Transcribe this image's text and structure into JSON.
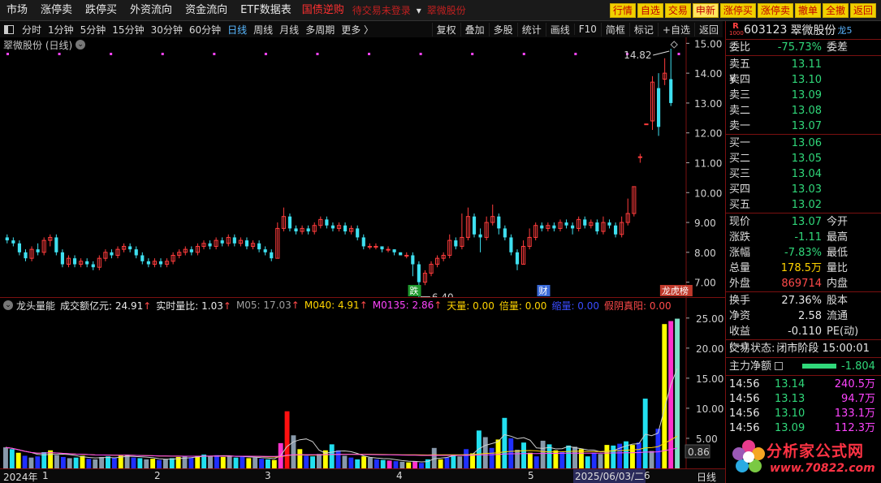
{
  "menu": {
    "items": [
      "市场",
      "涨停卖",
      "跌停买",
      "外资流向",
      "资金流向",
      "ETF数据表"
    ],
    "ticker_red": "国债逆购",
    "ticker_status": "待交易未登录",
    "ticker_stock": "翠微股份",
    "buttons": [
      "行情",
      "自选",
      "交易",
      "申新",
      "涨停买",
      "涨停卖",
      "撤单",
      "全撤",
      "返回"
    ]
  },
  "periods": {
    "items": [
      "分时",
      "1分钟",
      "5分钟",
      "15分钟",
      "30分钟",
      "60分钟",
      "日线",
      "周线",
      "月线",
      "多周期",
      "更多 〉"
    ],
    "active_index": 6
  },
  "toolbar": [
    "复权",
    "叠加",
    "多股",
    "统计",
    "画线",
    "F10",
    "简框",
    "标记",
    "+自选",
    "返回"
  ],
  "kline": {
    "title": "翠微股份 (日线)",
    "price_labels": [
      "15.00",
      "14.00",
      "13.00",
      "12.00",
      "11.00",
      "10.00",
      "9.00",
      "8.00",
      "7.00"
    ],
    "high_label": "14.82",
    "low_label": "6.40",
    "event_tags": [
      "跌",
      "财",
      "龙虎榜"
    ],
    "event_tag_colors": [
      "#1f9a2e",
      "#3a6ad8",
      "#c0392b"
    ]
  },
  "volume": {
    "indicator_name": "龙头量能",
    "legend": [
      {
        "label": "成交额亿元: 24.91",
        "color": "#e8e8e8",
        "arrow": "↑"
      },
      {
        "label": "实时量比: 1.03",
        "color": "#e8e8e8",
        "arrow": "↑"
      },
      {
        "label": "M05: 17.03",
        "color": "#a0a0a0",
        "arrow": "↑"
      },
      {
        "label": "M040: 4.91",
        "color": "#ffd400",
        "arrow": "↑"
      },
      {
        "label": "M0135: 2.86",
        "color": "#ff44ff",
        "arrow": "↑"
      },
      {
        "label": "天量: 0.00",
        "color": "#ffd400",
        "arrow": ""
      },
      {
        "label": "倍量: 0.00",
        "color": "#ffd400",
        "arrow": ""
      },
      {
        "label": "缩量: 0.00",
        "color": "#3a4cff",
        "arrow": ""
      },
      {
        "label": "假阴真阳: 0.00",
        "color": "#ff4a4a",
        "arrow": ""
      }
    ],
    "y_labels": [
      "25.00",
      "20.00",
      "15.00",
      "10.00",
      "5.00"
    ],
    "current_label": "0.86"
  },
  "xaxis": {
    "labels": [
      "2024年",
      "1",
      "2",
      "3",
      "4",
      "5",
      "2025/06/03/二",
      "6",
      "日线"
    ]
  },
  "quote": {
    "market_badge": "R",
    "market_sub": "1000",
    "code": "603123",
    "name": "翠微股份",
    "dragon": "龙5",
    "weibi_label": "委比",
    "weibi_value": "-75.73%",
    "weicha_label": "委差",
    "asks": [
      {
        "label": "卖五 ¥",
        "price": "13.11"
      },
      {
        "label": "卖四",
        "price": "13.10"
      },
      {
        "label": "卖三",
        "price": "13.09"
      },
      {
        "label": "卖二",
        "price": "13.08"
      },
      {
        "label": "卖一",
        "price": "13.07"
      }
    ],
    "bids": [
      {
        "label": "买一",
        "price": "13.06"
      },
      {
        "label": "买二",
        "price": "13.05"
      },
      {
        "label": "买三",
        "price": "13.04"
      },
      {
        "label": "买四",
        "price": "13.03"
      },
      {
        "label": "买五",
        "price": "13.02"
      }
    ],
    "stats": [
      {
        "label": "现价",
        "value": "13.07",
        "color": "green",
        "label2": "今开"
      },
      {
        "label": "涨跌",
        "value": "-1.11",
        "color": "green",
        "label2": "最高"
      },
      {
        "label": "涨幅",
        "value": "-7.83%",
        "color": "green",
        "label2": "最低"
      },
      {
        "label": "总量",
        "value": "178.5万",
        "color": "yellow",
        "label2": "量比"
      },
      {
        "label": "外盘",
        "value": "869714",
        "color": "red",
        "label2": "内盘"
      }
    ],
    "stats2": [
      {
        "label": "换手",
        "value": "27.36%",
        "label2": "股本"
      },
      {
        "label": "净资",
        "value": "2.58",
        "label2": "流通"
      },
      {
        "label": "收益(一)",
        "value": "-0.110",
        "label2": "PE(动)"
      }
    ],
    "trade_status_label": "交易状态:",
    "trade_status_value": "闭市阶段 15:00:01",
    "main_flow_label": "主力净额",
    "main_flow_value": "-1.804",
    "ticks": [
      {
        "time": "14:56",
        "price": "13.14",
        "vol": "240.5万"
      },
      {
        "time": "14:56",
        "price": "13.13",
        "vol": "94.7万"
      },
      {
        "time": "14:56",
        "price": "13.10",
        "vol": "133.1万"
      },
      {
        "time": "14:56",
        "price": "13.09",
        "vol": "112.3万"
      }
    ],
    "brand": "分析家公式网",
    "brand_url": "www.70822.com"
  },
  "chart_data": [
    {
      "type": "candlestick",
      "title": "翠微股份 (日线)",
      "ylim": [
        6.5,
        15.2
      ],
      "high": 14.82,
      "low": 6.4,
      "candles": [
        [
          8.5,
          8.4,
          8.6,
          8.3
        ],
        [
          8.4,
          8.3,
          8.5,
          8.2
        ],
        [
          8.3,
          8.0,
          8.4,
          7.9
        ],
        [
          8.0,
          7.8,
          8.1,
          7.7
        ],
        [
          7.8,
          8.1,
          8.2,
          7.7
        ],
        [
          8.1,
          8.0,
          8.3,
          7.9
        ],
        [
          8.0,
          8.4,
          8.5,
          7.9
        ],
        [
          8.4,
          8.5,
          8.6,
          8.2
        ],
        [
          8.5,
          8.0,
          8.6,
          7.9
        ],
        [
          8.0,
          7.6,
          8.1,
          7.5
        ],
        [
          7.6,
          7.8,
          7.9,
          7.5
        ],
        [
          7.8,
          7.6,
          7.9,
          7.5
        ],
        [
          7.6,
          7.7,
          7.8,
          7.5
        ],
        [
          7.7,
          7.6,
          7.8,
          7.5
        ],
        [
          7.6,
          7.5,
          7.7,
          7.4
        ],
        [
          7.5,
          7.8,
          7.9,
          7.4
        ],
        [
          7.8,
          8.0,
          8.1,
          7.7
        ],
        [
          8.0,
          7.9,
          8.1,
          7.8
        ],
        [
          7.9,
          8.1,
          8.2,
          7.8
        ],
        [
          8.1,
          8.2,
          8.3,
          8.0
        ],
        [
          8.2,
          8.1,
          8.3,
          8.0
        ],
        [
          8.1,
          7.9,
          8.2,
          7.8
        ],
        [
          7.9,
          7.7,
          8.0,
          7.6
        ],
        [
          7.7,
          7.6,
          7.8,
          7.5
        ],
        [
          7.6,
          7.7,
          7.8,
          7.5
        ],
        [
          7.7,
          7.6,
          7.8,
          7.5
        ],
        [
          7.6,
          7.7,
          7.8,
          7.5
        ],
        [
          7.7,
          7.9,
          8.0,
          7.6
        ],
        [
          7.9,
          8.0,
          8.1,
          7.8
        ],
        [
          8.0,
          8.1,
          8.2,
          7.9
        ],
        [
          8.1,
          8.0,
          8.2,
          7.9
        ],
        [
          8.0,
          8.2,
          8.3,
          7.9
        ],
        [
          8.2,
          8.3,
          8.4,
          8.1
        ],
        [
          8.3,
          8.2,
          8.4,
          8.1
        ],
        [
          8.2,
          8.4,
          8.5,
          8.1
        ],
        [
          8.4,
          8.3,
          8.5,
          8.2
        ],
        [
          8.3,
          8.5,
          8.6,
          8.2
        ],
        [
          8.5,
          8.3,
          8.6,
          8.2
        ],
        [
          8.3,
          8.4,
          8.5,
          8.2
        ],
        [
          8.4,
          8.2,
          8.5,
          8.1
        ],
        [
          8.2,
          8.3,
          8.4,
          8.1
        ],
        [
          8.3,
          8.1,
          8.4,
          8.0
        ],
        [
          8.1,
          8.0,
          8.2,
          7.9
        ],
        [
          8.0,
          7.8,
          8.1,
          7.7
        ],
        [
          7.8,
          8.8,
          9.0,
          7.8
        ],
        [
          8.8,
          9.2,
          9.5,
          8.7
        ],
        [
          9.2,
          8.8,
          9.3,
          8.7
        ],
        [
          8.8,
          8.7,
          8.9,
          8.6
        ],
        [
          8.7,
          8.8,
          8.9,
          8.6
        ],
        [
          8.8,
          8.7,
          8.9,
          8.6
        ],
        [
          8.7,
          8.9,
          9.0,
          8.6
        ],
        [
          8.9,
          9.1,
          9.2,
          8.8
        ],
        [
          9.1,
          8.9,
          9.2,
          8.8
        ],
        [
          8.9,
          8.8,
          9.0,
          8.7
        ],
        [
          8.8,
          8.9,
          9.0,
          8.7
        ],
        [
          8.9,
          8.7,
          9.0,
          8.6
        ],
        [
          8.7,
          8.8,
          8.9,
          8.6
        ],
        [
          8.8,
          8.5,
          8.9,
          8.4
        ],
        [
          8.5,
          8.2,
          8.6,
          8.1
        ],
        [
          8.2,
          8.2,
          8.3,
          8.1
        ],
        [
          8.2,
          8.2,
          8.3,
          8.1
        ],
        [
          8.2,
          8.1,
          8.2,
          8.0
        ],
        [
          8.1,
          8.1,
          8.2,
          8.0
        ],
        [
          8.1,
          8.0,
          8.1,
          7.9
        ],
        [
          8.0,
          7.9,
          8.0,
          7.9
        ],
        [
          7.9,
          7.9,
          8.0,
          7.8
        ],
        [
          7.9,
          7.6,
          8.0,
          7.2
        ],
        [
          7.6,
          7.0,
          7.7,
          6.4
        ],
        [
          7.0,
          7.3,
          7.4,
          6.9
        ],
        [
          7.3,
          7.6,
          7.7,
          7.2
        ],
        [
          7.6,
          7.8,
          7.9,
          7.5
        ],
        [
          7.8,
          7.9,
          8.0,
          7.7
        ],
        [
          7.9,
          8.4,
          8.6,
          7.8
        ],
        [
          8.4,
          8.2,
          8.5,
          8.1
        ],
        [
          8.2,
          8.5,
          9.3,
          8.1
        ],
        [
          8.5,
          9.2,
          9.5,
          8.4
        ],
        [
          9.2,
          8.6,
          9.3,
          8.5
        ],
        [
          8.6,
          8.5,
          8.8,
          8.0
        ],
        [
          8.5,
          9.0,
          9.2,
          8.4
        ],
        [
          9.0,
          9.2,
          9.6,
          8.9
        ],
        [
          9.2,
          8.8,
          9.3,
          8.6
        ],
        [
          8.8,
          8.5,
          8.9,
          8.4
        ],
        [
          8.5,
          8.0,
          8.6,
          7.9
        ],
        [
          8.0,
          7.6,
          8.1,
          7.4
        ],
        [
          7.6,
          8.2,
          8.4,
          7.6
        ],
        [
          8.2,
          8.5,
          8.8,
          8.1
        ],
        [
          8.5,
          8.9,
          9.0,
          8.4
        ],
        [
          8.9,
          8.8,
          9.0,
          8.7
        ],
        [
          8.8,
          8.9,
          9.0,
          8.7
        ],
        [
          8.9,
          8.8,
          9.0,
          8.7
        ],
        [
          8.8,
          9.0,
          9.1,
          8.7
        ],
        [
          9.0,
          8.9,
          9.1,
          8.8
        ],
        [
          8.9,
          8.8,
          9.0,
          8.6
        ],
        [
          8.8,
          9.1,
          9.2,
          8.7
        ],
        [
          9.1,
          8.9,
          9.2,
          8.8
        ],
        [
          8.9,
          9.0,
          9.1,
          8.8
        ],
        [
          9.0,
          8.7,
          9.1,
          8.6
        ],
        [
          8.7,
          9.0,
          9.2,
          8.6
        ],
        [
          9.0,
          8.9,
          9.1,
          8.8
        ],
        [
          8.9,
          8.6,
          9.0,
          8.5
        ],
        [
          8.6,
          9.0,
          9.2,
          8.5
        ],
        [
          9.0,
          9.3,
          9.8,
          8.9
        ],
        [
          9.3,
          10.2,
          10.2,
          9.2
        ],
        [
          11.2,
          11.2,
          11.3,
          11.0
        ],
        [
          12.3,
          12.3,
          12.3,
          12.3
        ],
        [
          12.4,
          13.7,
          13.9,
          12.1
        ],
        [
          13.5,
          12.2,
          14.0,
          11.9
        ],
        [
          13.8,
          14.0,
          14.5,
          13.6
        ],
        [
          13.8,
          13.0,
          14.82,
          12.9
        ]
      ]
    },
    {
      "type": "bar",
      "title": "龙头量能",
      "ylim": [
        0,
        27
      ],
      "values": [
        3.5,
        3.2,
        2.6,
        2.1,
        1.8,
        2.0,
        2.7,
        3.0,
        2.2,
        1.9,
        1.7,
        1.8,
        2.1,
        1.6,
        1.5,
        1.9,
        2.0,
        1.8,
        2.1,
        2.3,
        1.8,
        1.7,
        1.5,
        1.6,
        1.4,
        1.5,
        1.7,
        1.9,
        2.0,
        1.8,
        2.1,
        2.3,
        2.0,
        2.2,
        1.9,
        2.1,
        1.8,
        2.0,
        1.7,
        1.8,
        1.6,
        1.5,
        1.4,
        4.2,
        9.5,
        5.5,
        3.2,
        2.1,
        2.0,
        2.4,
        3.0,
        4.0,
        3.0,
        2.1,
        1.8,
        1.5,
        2.0,
        1.8,
        1.5,
        1.4,
        1.3,
        1.2,
        1.1,
        1.0,
        1.2,
        0.9,
        1.5,
        3.4,
        1.5,
        1.8,
        2.3,
        2.0,
        3.2,
        2.5,
        6.3,
        5.2,
        3.4,
        4.8,
        8.4,
        5.0,
        3.1,
        4.3,
        2.6,
        2.0,
        4.6,
        4.0,
        3.0,
        2.8,
        3.8,
        3.6,
        3.2,
        2.0,
        2.6,
        2.4,
        3.9,
        3.8,
        4.1,
        4.5,
        3.9,
        4.3,
        11.6,
        2.9,
        6.6,
        24.0,
        24.5,
        24.9
      ],
      "colors": [
        3,
        1,
        0,
        2,
        3,
        2,
        1,
        0,
        3,
        2,
        3,
        1,
        0,
        2,
        3,
        3,
        1,
        2,
        0,
        3,
        2,
        1,
        3,
        0,
        2,
        3,
        1,
        0,
        3,
        2,
        0,
        1,
        3,
        2,
        0,
        3,
        1,
        2,
        0,
        3,
        2,
        1,
        0,
        4,
        5,
        3,
        0,
        2,
        1,
        3,
        0,
        1,
        2,
        3,
        2,
        1,
        0,
        3,
        2,
        1,
        4,
        2,
        3,
        0,
        4,
        2,
        1,
        3,
        0,
        2,
        1,
        3,
        2,
        0,
        1,
        3,
        2,
        0,
        1,
        2,
        3,
        1,
        0,
        2,
        3,
        1,
        0,
        2,
        1,
        3,
        0,
        1,
        2,
        3,
        0,
        1,
        2,
        1,
        0,
        2,
        1,
        3,
        2,
        0,
        4,
        3
      ]
    }
  ]
}
